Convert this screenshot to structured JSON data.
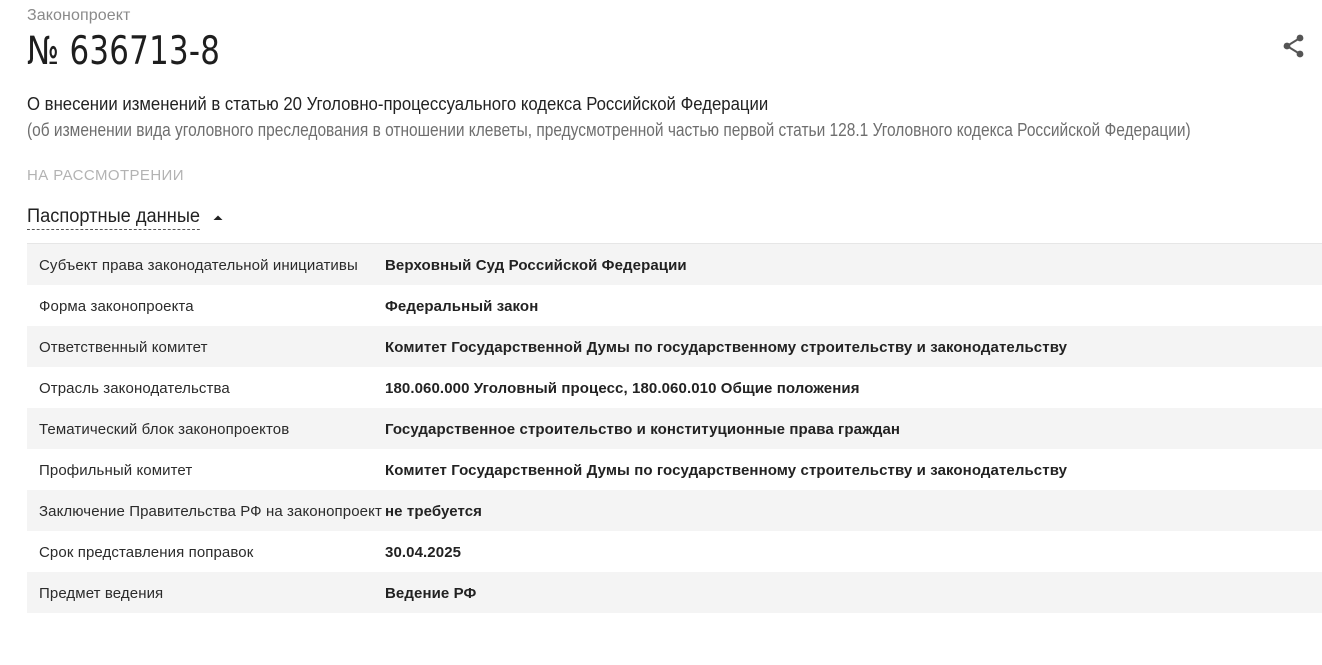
{
  "header": {
    "kicker": "Законопроект",
    "bill_number": "№ 636713-8",
    "title": "О внесении изменений в статью 20 Уголовно-процессуального кодекса Российской Федерации",
    "subtitle": "(об изменении вида уголовного преследования в отношении клеветы, предусмотренной частью первой статьи 128.1 Уголовного кодекса Российской Федерации)",
    "status": "НА РАССМОТРЕНИИ",
    "share_icon": "share-icon"
  },
  "passport": {
    "toggle_label": "Паспортные данные",
    "toggle_icon": "caret-up-icon",
    "rows": [
      {
        "key": "Субъект права законодательной инициативы",
        "value": "Верховный Суд Российской Федерации"
      },
      {
        "key": "Форма законопроекта",
        "value": "Федеральный закон"
      },
      {
        "key": "Ответственный комитет",
        "value": "Комитет Государственной Думы по государственному строительству и законодательству"
      },
      {
        "key": "Отрасль законодательства",
        "value": "180.060.000 Уголовный процесс, 180.060.010 Общие положения"
      },
      {
        "key": "Тематический блок законопроектов",
        "value": "Государственное строительство и конституционные права граждан"
      },
      {
        "key": "Профильный комитет",
        "value": "Комитет Государственной Думы по государственному строительству и законодательству"
      },
      {
        "key": "Заключение Правительства РФ на законопроект",
        "value": "не требуется"
      },
      {
        "key": "Срок представления поправок",
        "value": "30.04.2025"
      },
      {
        "key": "Предмет ведения",
        "value": "Ведение РФ"
      }
    ]
  },
  "colors": {
    "text": "#222222",
    "muted": "#8a8a8a",
    "status": "#b3b3b3",
    "row_shade": "#f4f4f4"
  }
}
